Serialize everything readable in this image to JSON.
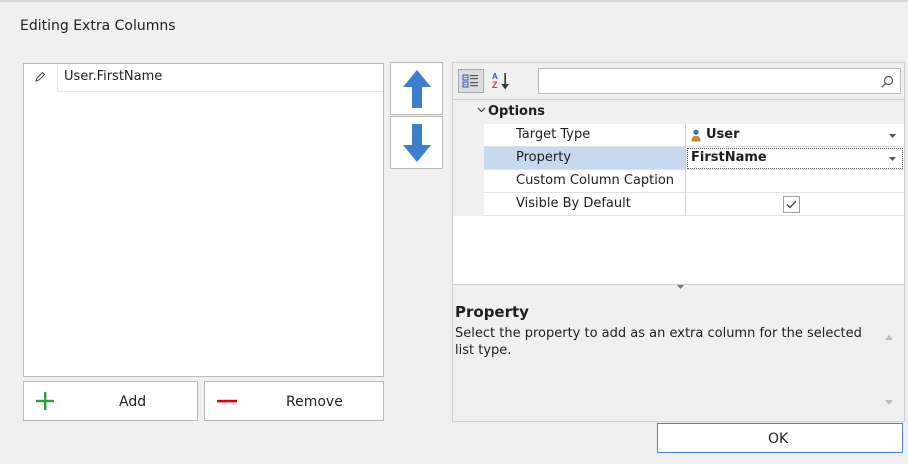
{
  "dialog": {
    "title": "Editing Extra Columns"
  },
  "columns_list": {
    "items": [
      {
        "label": "User.FirstName",
        "icon": "pencil-icon"
      }
    ]
  },
  "buttons": {
    "add": "Add",
    "remove": "Remove",
    "move_up_icon": "arrow-up-icon",
    "move_down_icon": "arrow-down-icon",
    "ok": "OK"
  },
  "property_grid": {
    "toolbar": {
      "categorized_icon": "categorized-icon",
      "alphabetical_icon": "sort-az-icon",
      "search_value": "",
      "search_icon": "search-icon"
    },
    "category": "Options",
    "rows": [
      {
        "name": "Target Type",
        "value": "User",
        "value_icon": "user-icon",
        "has_dropdown": true
      },
      {
        "name": "Property",
        "value": "FirstName",
        "has_dropdown": true,
        "selected": true
      },
      {
        "name": "Custom Column Caption",
        "value": ""
      },
      {
        "name": "Visible By Default",
        "checked": true
      }
    ],
    "description": {
      "title": "Property",
      "text": "Select the property to add as an extra column for the selected list type."
    }
  },
  "colors": {
    "accent_blue": "#3c7ed0",
    "add_green": "#2e9e3e",
    "remove_red": "#d0021b",
    "selected_row": "#c6d9f1"
  }
}
